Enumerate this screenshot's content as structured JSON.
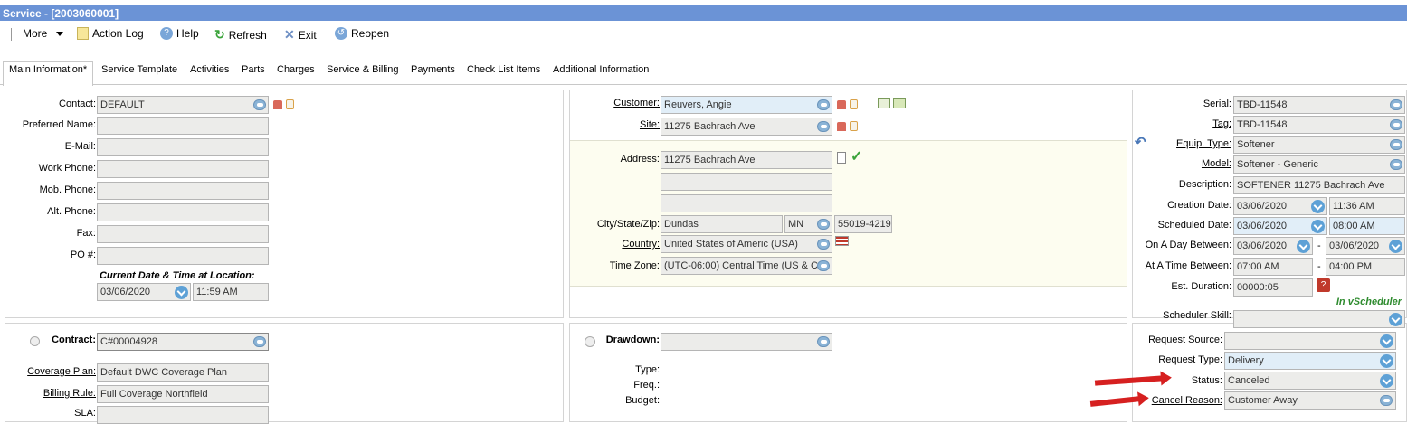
{
  "window": {
    "title": "Service - [2003060001]"
  },
  "toolbar": {
    "more": "More",
    "action_log": "Action Log",
    "help": "Help",
    "refresh": "Refresh",
    "exit": "Exit",
    "reopen": "Reopen"
  },
  "tabs": [
    "Main Information*",
    "Service Template",
    "Activities",
    "Parts",
    "Charges",
    "Service & Billing",
    "Payments",
    "Check List Items",
    "Additional Information"
  ],
  "contact_panel": {
    "contact_label": "Contact:",
    "contact_value": "DEFAULT",
    "preferred_name_label": "Preferred Name:",
    "email_label": "E-Mail:",
    "work_phone_label": "Work Phone:",
    "mob_phone_label": "Mob. Phone:",
    "alt_phone_label": "Alt. Phone:",
    "fax_label": "Fax:",
    "po_label": "PO #:",
    "current_dt_label": "Current Date & Time at Location:",
    "current_date": "03/06/2020",
    "current_time": "11:59 AM"
  },
  "customer_panel": {
    "customer_label": "Customer:",
    "customer_value": "Reuvers, Angie",
    "site_label": "Site:",
    "site_value": "11275 Bachrach Ave",
    "address_label": "Address:",
    "address1": "11275 Bachrach Ave",
    "address2": "",
    "address3": "",
    "city_label": "City/State/Zip:",
    "city": "Dundas",
    "state": "MN",
    "zip": "55019-4219",
    "country_label": "Country:",
    "country": "United States of Americ (USA)",
    "timezone_label": "Time Zone:",
    "timezone": "(UTC-06:00) Central Time (US & C"
  },
  "equipment_panel": {
    "serial_label": "Serial:",
    "serial": "TBD-11548",
    "tag_label": "Tag:",
    "tag": "TBD-11548",
    "equip_type_label": "Equip. Type:",
    "equip_type": "Softener",
    "model_label": "Model:",
    "model": "Softener - Generic",
    "description_label": "Description:",
    "description": "SOFTENER 11275 Bachrach Ave",
    "creation_label": "Creation Date:",
    "creation_date": "03/06/2020",
    "creation_time": "11:36 AM",
    "scheduled_label": "Scheduled Date:",
    "scheduled_date": "03/06/2020",
    "scheduled_time": "08:00 AM",
    "day_between_label": "On A Day Between:",
    "day_from": "03/06/2020",
    "day_to": "03/06/2020",
    "time_between_label": "At A Time Between:",
    "time_from": "07:00 AM",
    "time_to": "04:00 PM",
    "duration_label": "Est. Duration:",
    "duration": "00000:05",
    "vscheduler": "In vScheduler",
    "dash": "-",
    "skill_label": "Scheduler Skill:",
    "skill": ""
  },
  "contract_panel": {
    "contract_label": "Contract:",
    "contract": "C#00004928",
    "coverage_label": "Coverage Plan:",
    "coverage": "Default DWC Coverage Plan",
    "billing_label": "Billing Rule:",
    "billing": "Full Coverage Northfield",
    "sla_label": "SLA:"
  },
  "drawdown_panel": {
    "drawdown_label": "Drawdown:",
    "type_label": "Type:",
    "freq_label": "Freq.:",
    "budget_label": "Budget:"
  },
  "request_panel": {
    "source_label": "Request Source:",
    "source": "",
    "type_label": "Request Type:",
    "type": "Delivery",
    "status_label": "Status:",
    "status": "Canceled",
    "cancel_label": "Cancel Reason:",
    "cancel": "Customer Away"
  },
  "colors": {
    "title_bar": "#6b93d6",
    "arrow": "#d62020",
    "vscheduler": "#2e8b2e"
  }
}
